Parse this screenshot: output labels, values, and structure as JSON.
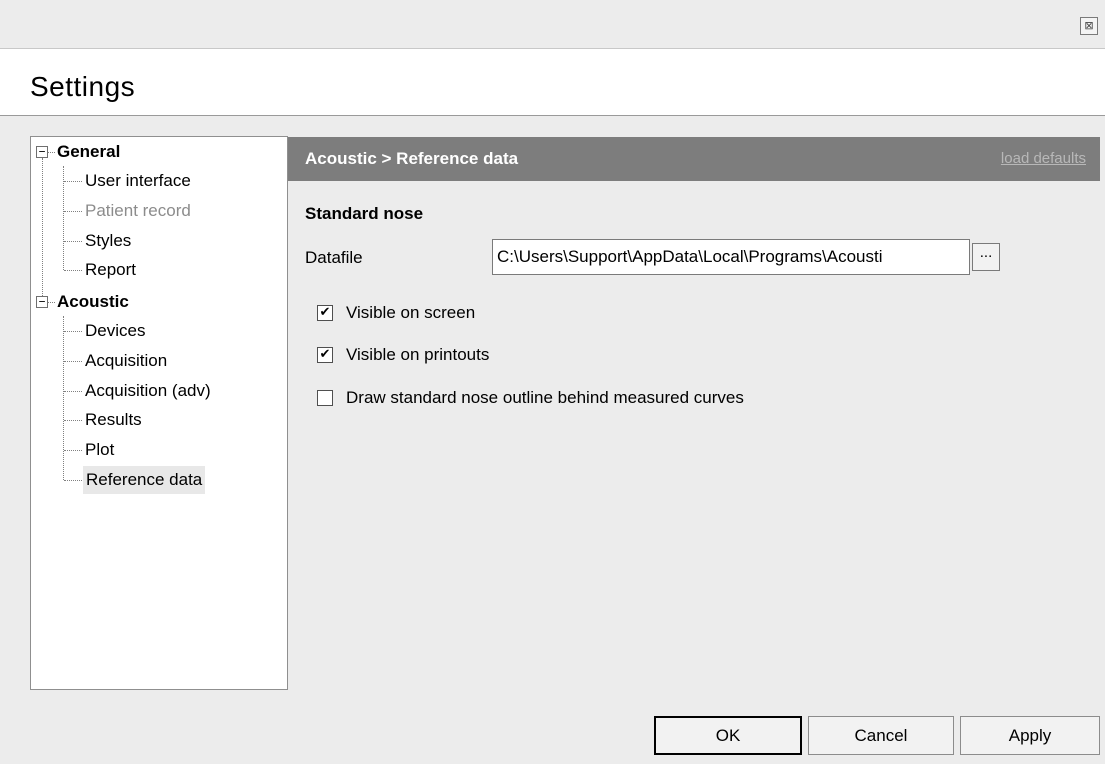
{
  "window": {
    "close_glyph": "⊠",
    "title": "Settings"
  },
  "tree": {
    "groups": [
      {
        "label": "General",
        "expander": "−",
        "items": [
          {
            "label": "User interface",
            "disabled": false
          },
          {
            "label": "Patient record",
            "disabled": true
          },
          {
            "label": "Styles",
            "disabled": false
          },
          {
            "label": "Report",
            "disabled": false
          }
        ]
      },
      {
        "label": "Acoustic",
        "expander": "−",
        "items": [
          {
            "label": "Devices",
            "disabled": false
          },
          {
            "label": "Acquisition",
            "disabled": false
          },
          {
            "label": "Acquisition (adv)",
            "disabled": false
          },
          {
            "label": "Results",
            "disabled": false
          },
          {
            "label": "Plot",
            "disabled": false
          },
          {
            "label": "Reference data",
            "disabled": false,
            "selected": true
          }
        ]
      }
    ]
  },
  "panel": {
    "breadcrumb": "Acoustic > Reference data",
    "load_defaults": "load defaults",
    "section_title": "Standard nose",
    "datafile_label": "Datafile",
    "datafile_value": "C:\\Users\\Support\\AppData\\Local\\Programs\\Acousti",
    "browse_label": "...",
    "options": [
      {
        "label": "Visible on screen",
        "checked": true
      },
      {
        "label": "Visible on printouts",
        "checked": true
      },
      {
        "label": "Draw standard nose outline behind measured curves",
        "checked": false
      }
    ]
  },
  "buttons": {
    "ok": "OK",
    "cancel": "Cancel",
    "apply": "Apply"
  },
  "colors": {
    "panel_header_bg": "#7d7d7d",
    "panel_header_text": "#ffffff",
    "window_bg": "#ececec"
  }
}
